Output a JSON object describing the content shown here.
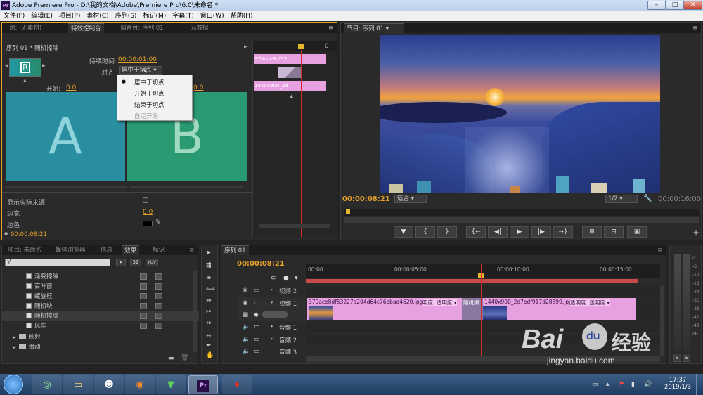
{
  "window": {
    "title": "Adobe Premiere Pro - D:\\我的文档\\Adobe\\Premiere Pro\\6.0\\未命名 *",
    "app_icon": "Pr"
  },
  "menu": [
    "文件(F)",
    "编辑(E)",
    "项目(P)",
    "素材(C)",
    "序列(S)",
    "标记(M)",
    "字幕(T)",
    "窗口(W)",
    "帮助(H)"
  ],
  "top_left": {
    "tabs": [
      "源: (无素材)",
      "特效控制台",
      "调音台: 序列 01",
      "元数据"
    ],
    "header": "序列 01 * 随机擦除",
    "duration_label": "持续时间",
    "duration_value": "00:00:01:00",
    "align_label": "对齐:",
    "align_value": "居中于切点",
    "start_label": "开始:",
    "start_value": "0.0",
    "end_value": "0.0",
    "clip_a": "A",
    "clip_b": "B",
    "clip_name_1": "370ace8df53",
    "clip_name_2": "1440x900_2d",
    "zero_label": "0",
    "dropdown_options": [
      "居中于切点",
      "开始于切点",
      "结束于切点",
      "自定开始"
    ],
    "show_source_label": "显示实际来源",
    "border_width_label": "边宽",
    "border_width_value": "0.0",
    "border_color_label": "边色",
    "timecode": "00:00:08:21"
  },
  "program": {
    "tab": "节目: 序列 01",
    "timecode": "00:00:08:21",
    "fit": "适合",
    "resolution": "1/2",
    "duration": "00:00:16:00",
    "controls": [
      "marker-icon",
      "in-point-icon",
      "out-point-icon",
      "go-to-in-icon",
      "step-back-icon",
      "play-icon",
      "step-forward-icon",
      "go-to-out-icon",
      "lift-icon",
      "extract-icon",
      "export-frame-icon"
    ]
  },
  "project": {
    "tabs": [
      "项目: 未命名",
      "媒体浏览器",
      "信息",
      "效果",
      "标记"
    ],
    "items": [
      "渐变擦除",
      "百叶窗",
      "螺旋框",
      "随机块",
      "随机擦除",
      "风车"
    ],
    "folders": [
      "映射",
      "滑动"
    ],
    "badges": [
      "32",
      "YUV"
    ]
  },
  "sequence": {
    "tab": "序列 01",
    "timecode": "00:00:08:21",
    "ruler": [
      "00:00",
      "00:00:05:00",
      "00:00:10:00",
      "00:00:15:00"
    ],
    "tracks": [
      {
        "name": "视频 2",
        "type": "video"
      },
      {
        "name": "视频 1",
        "type": "video"
      },
      {
        "name": "音频 1",
        "type": "audio"
      },
      {
        "name": "音频 2",
        "type": "audio"
      },
      {
        "name": "音频 3",
        "type": "audio"
      }
    ],
    "clip1": "370ace8df53227a204d64c76ebad4620.jpg",
    "clip1_fx": "明度 :透明度 ▾",
    "transition": "随机擦",
    "clip2": "1440x900_2d7edf917d28899.jpg",
    "clip2_fx": "透明度 :透明度 ▾"
  },
  "audio_meter": {
    "labels": [
      "0",
      "-6",
      "-12",
      "-18",
      "-24",
      "-30",
      "-36",
      "-42",
      "-48",
      "dB"
    ],
    "solo": [
      "S",
      "S"
    ]
  },
  "watermark": {
    "brand": "Bai",
    "paw": "du",
    "cn": "经验",
    "url": "jingyan.baidu.com"
  },
  "taskbar": {
    "time": "17:37",
    "date": "2019/1/3"
  },
  "colors": {
    "accent": "#e6a22b",
    "timecode": "#e6a22b",
    "clip": "#e8a1e0",
    "playhead": "#d12a2a",
    "blue": "#4a9fe8"
  }
}
